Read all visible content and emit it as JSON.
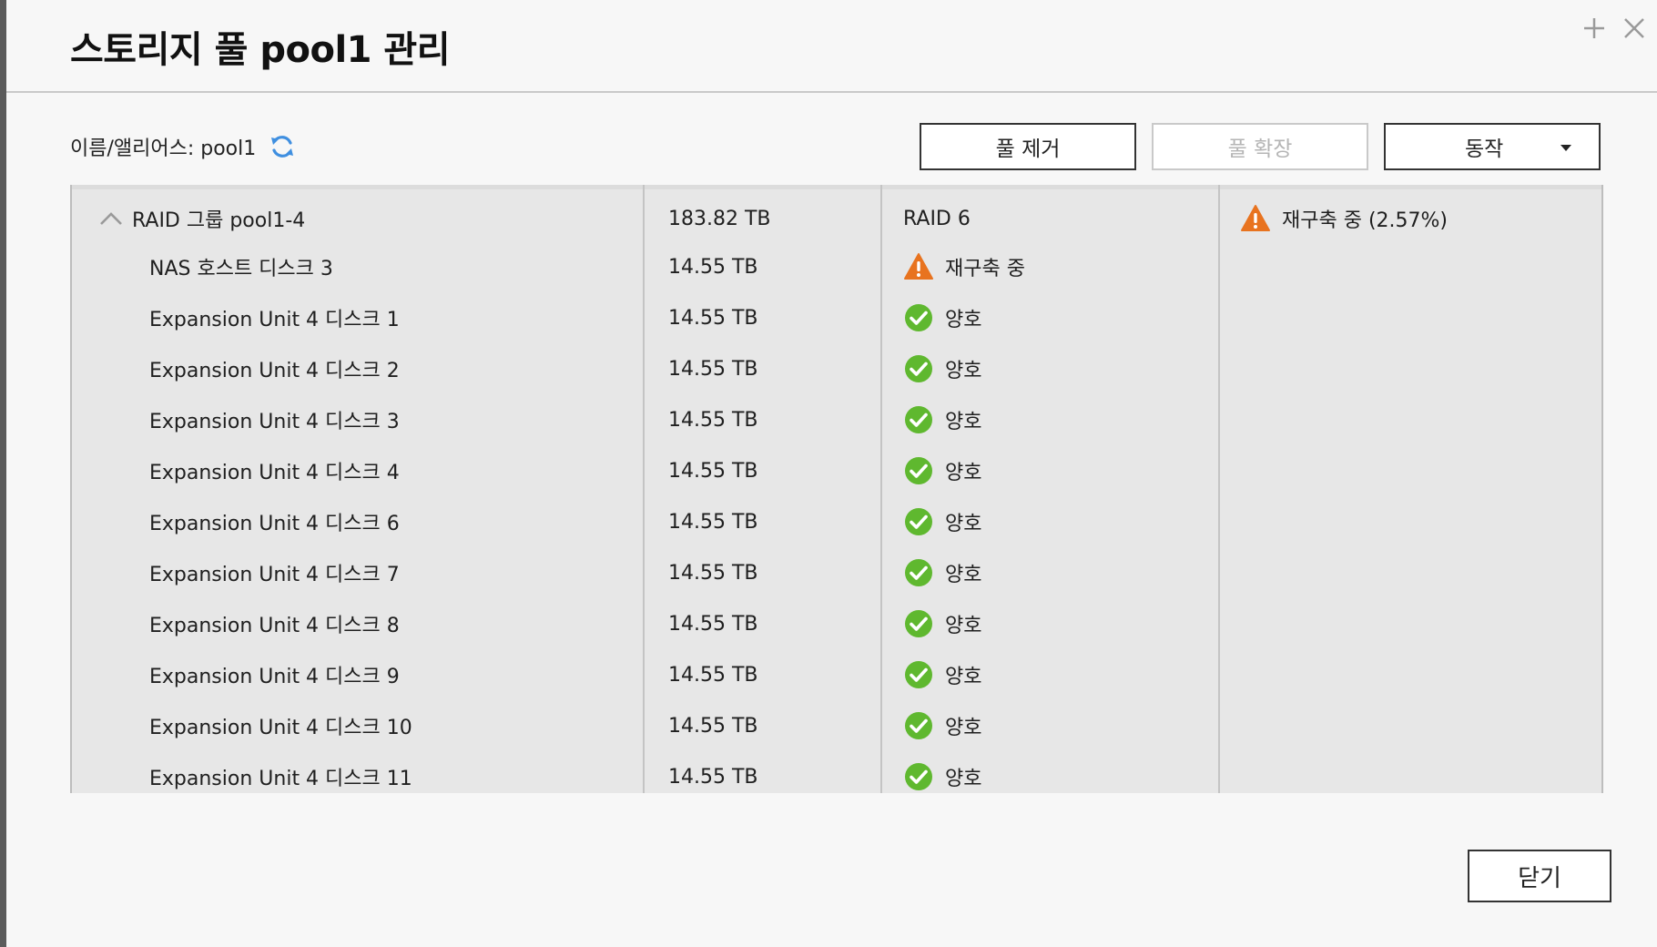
{
  "dialog": {
    "title": "스토리지 풀 pool1 관리",
    "alias_label": "이름/앨리어스: pool1",
    "buttons": {
      "remove_pool": "풀 제거",
      "expand_pool": "풀 확장",
      "action": "동작"
    },
    "close_label": "닫기"
  },
  "raid_group": {
    "name": "RAID 그룹 pool1-4",
    "capacity": "183.82 TB",
    "raid_level": "RAID 6",
    "status": "재구축 중 (2.57%)"
  },
  "disks": [
    {
      "name": "NAS 호스트 디스크 3",
      "capacity": "14.55 TB",
      "status": "재구축 중",
      "state": "warning"
    },
    {
      "name": "Expansion Unit 4 디스크 1",
      "capacity": "14.55 TB",
      "status": "양호",
      "state": "ok"
    },
    {
      "name": "Expansion Unit 4 디스크 2",
      "capacity": "14.55 TB",
      "status": "양호",
      "state": "ok"
    },
    {
      "name": "Expansion Unit 4 디스크 3",
      "capacity": "14.55 TB",
      "status": "양호",
      "state": "ok"
    },
    {
      "name": "Expansion Unit 4 디스크 4",
      "capacity": "14.55 TB",
      "status": "양호",
      "state": "ok"
    },
    {
      "name": "Expansion Unit 4 디스크 6",
      "capacity": "14.55 TB",
      "status": "양호",
      "state": "ok"
    },
    {
      "name": "Expansion Unit 4 디스크 7",
      "capacity": "14.55 TB",
      "status": "양호",
      "state": "ok"
    },
    {
      "name": "Expansion Unit 4 디스크 8",
      "capacity": "14.55 TB",
      "status": "양호",
      "state": "ok"
    },
    {
      "name": "Expansion Unit 4 디스크 9",
      "capacity": "14.55 TB",
      "status": "양호",
      "state": "ok"
    },
    {
      "name": "Expansion Unit 4 디스크 10",
      "capacity": "14.55 TB",
      "status": "양호",
      "state": "ok"
    },
    {
      "name": "Expansion Unit 4 디스크 11",
      "capacity": "14.55 TB",
      "status": "양호",
      "state": "ok"
    }
  ],
  "colors": {
    "warning": "#e8731f",
    "ok": "#5fb82f",
    "refresh": "#3f8fe0"
  },
  "icons": {
    "ok": "check-circle-icon",
    "warning": "warning-triangle-icon",
    "refresh": "refresh-icon"
  }
}
